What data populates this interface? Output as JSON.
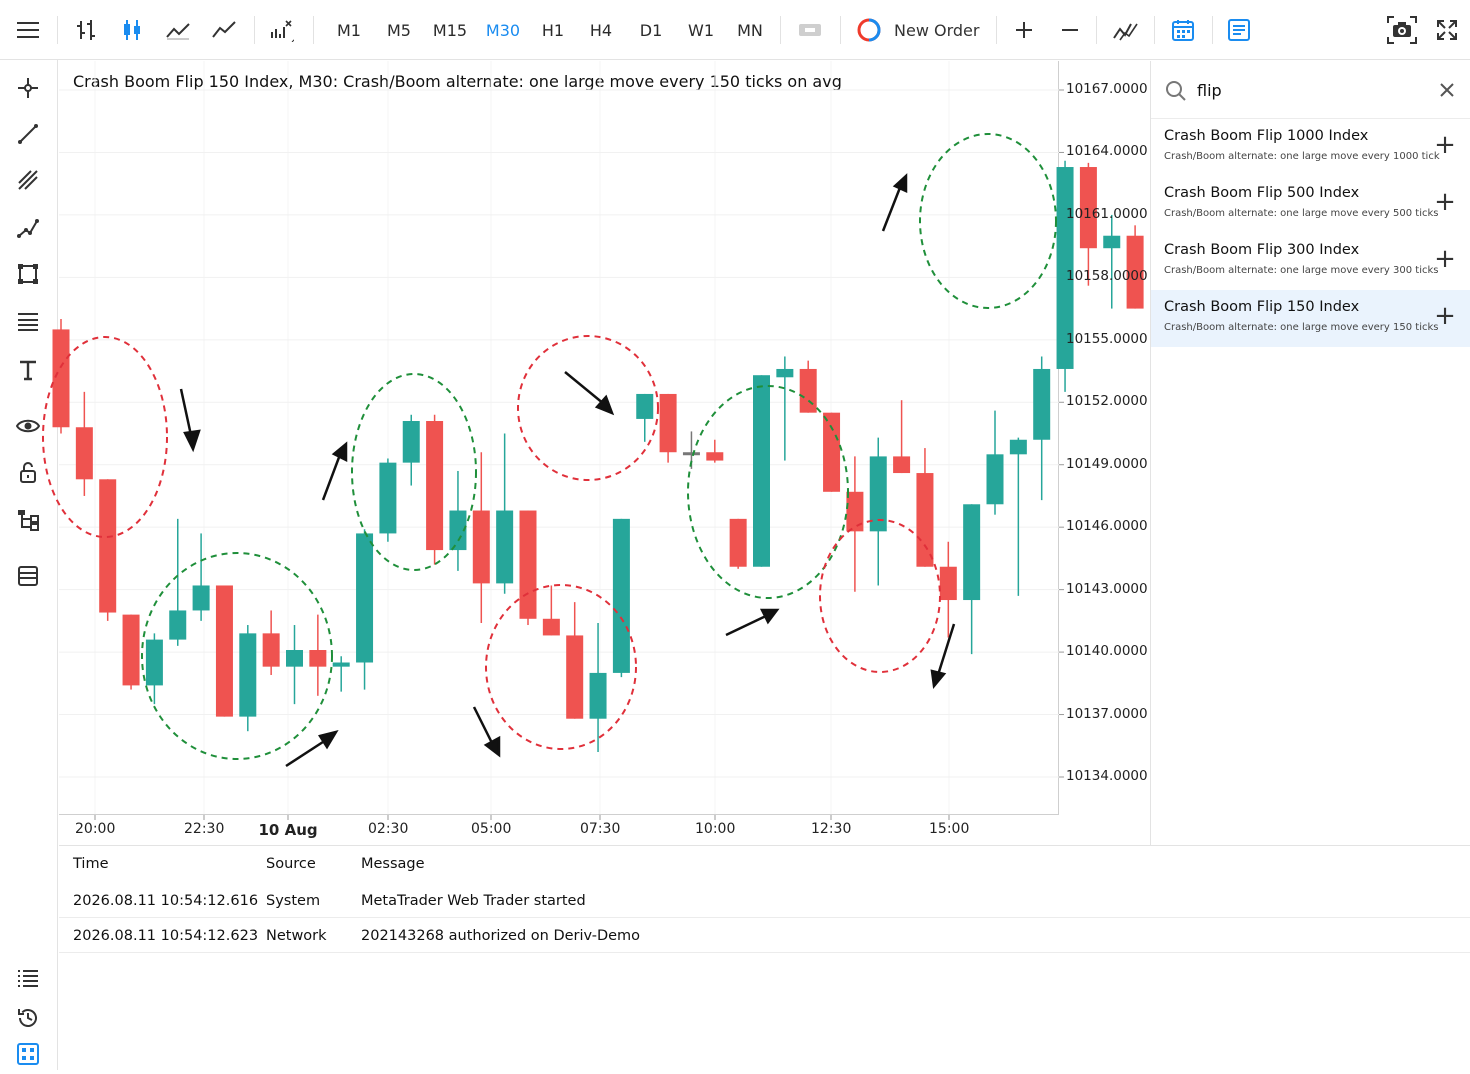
{
  "toolbar": {
    "timeframes": [
      "M1",
      "M5",
      "M15",
      "M30",
      "H1",
      "H4",
      "D1",
      "W1",
      "MN"
    ],
    "active_timeframe": "M30",
    "new_order_label": "New Order"
  },
  "chart": {
    "title": "Crash Boom Flip 150 Index, M30: Crash/Boom alternate: one large move every 150 ticks on avg",
    "y_labels": [
      "10167.0000",
      "10164.0000",
      "10161.0000",
      "10158.0000",
      "10155.0000",
      "10152.0000",
      "10149.0000",
      "10146.0000",
      "10143.0000",
      "10140.0000",
      "10137.0000",
      "10134.0000"
    ],
    "x_labels": [
      "20:00",
      "22:30",
      "10 Aug",
      "02:30",
      "05:00",
      "07:30",
      "10:00",
      "12:30",
      "15:00"
    ]
  },
  "chart_data": {
    "type": "candlestick",
    "symbol": "Crash Boom Flip 150 Index",
    "timeframe": "M30",
    "ylim": [
      10133,
      10168
    ],
    "up_color": "#26a69a",
    "down_color": "#ef5350",
    "candles": [
      {
        "o": 10155.5,
        "h": 10156.0,
        "l": 10150.5,
        "c": 10150.8
      },
      {
        "o": 10150.8,
        "h": 10152.5,
        "l": 10147.5,
        "c": 10148.3
      },
      {
        "o": 10148.3,
        "h": 10148.3,
        "l": 10141.5,
        "c": 10141.9
      },
      {
        "o": 10141.8,
        "h": 10141.8,
        "l": 10138.2,
        "c": 10138.4
      },
      {
        "o": 10138.4,
        "h": 10140.9,
        "l": 10137.5,
        "c": 10140.6
      },
      {
        "o": 10140.6,
        "h": 10146.4,
        "l": 10140.3,
        "c": 10142.0
      },
      {
        "o": 10142.0,
        "h": 10145.7,
        "l": 10141.5,
        "c": 10143.2
      },
      {
        "o": 10143.2,
        "h": 10143.2,
        "l": 10136.9,
        "c": 10136.9
      },
      {
        "o": 10136.9,
        "h": 10141.3,
        "l": 10136.2,
        "c": 10140.9
      },
      {
        "o": 10140.9,
        "h": 10142.0,
        "l": 10138.9,
        "c": 10139.3
      },
      {
        "o": 10139.3,
        "h": 10141.3,
        "l": 10137.5,
        "c": 10140.1
      },
      {
        "o": 10140.1,
        "h": 10141.8,
        "l": 10137.9,
        "c": 10139.3
      },
      {
        "o": 10139.3,
        "h": 10139.8,
        "l": 10138.1,
        "c": 10139.5
      },
      {
        "o": 10139.5,
        "h": 10145.9,
        "l": 10138.2,
        "c": 10145.7
      },
      {
        "o": 10145.7,
        "h": 10149.3,
        "l": 10145.3,
        "c": 10149.1
      },
      {
        "o": 10149.1,
        "h": 10151.4,
        "l": 10148.0,
        "c": 10151.1
      },
      {
        "o": 10151.1,
        "h": 10151.4,
        "l": 10144.2,
        "c": 10144.9
      },
      {
        "o": 10144.9,
        "h": 10148.7,
        "l": 10143.9,
        "c": 10146.8
      },
      {
        "o": 10146.8,
        "h": 10149.6,
        "l": 10141.4,
        "c": 10143.3
      },
      {
        "o": 10143.3,
        "h": 10150.5,
        "l": 10142.8,
        "c": 10146.8
      },
      {
        "o": 10146.8,
        "h": 10146.8,
        "l": 10141.3,
        "c": 10141.6
      },
      {
        "o": 10141.6,
        "h": 10143.2,
        "l": 10140.8,
        "c": 10140.8
      },
      {
        "o": 10140.8,
        "h": 10142.4,
        "l": 10136.8,
        "c": 10136.8
      },
      {
        "o": 10136.8,
        "h": 10141.4,
        "l": 10135.2,
        "c": 10139.0
      },
      {
        "o": 10139.0,
        "h": 10146.4,
        "l": 10138.8,
        "c": 10146.4
      },
      {
        "o": 10151.2,
        "h": 10152.4,
        "l": 10150.1,
        "c": 10152.4
      },
      {
        "o": 10152.4,
        "h": 10152.4,
        "l": 10149.1,
        "c": 10149.6
      },
      {
        "o": 10149.6,
        "h": 10150.6,
        "l": 10148.8,
        "c": 10149.5
      },
      {
        "o": 10149.6,
        "h": 10150.2,
        "l": 10149.1,
        "c": 10149.2
      },
      {
        "o": 10146.4,
        "h": 10146.4,
        "l": 10144.0,
        "c": 10144.1
      },
      {
        "o": 10144.1,
        "h": 10153.3,
        "l": 10144.1,
        "c": 10153.3
      },
      {
        "o": 10153.2,
        "h": 10154.2,
        "l": 10149.2,
        "c": 10153.6
      },
      {
        "o": 10153.6,
        "h": 10154.0,
        "l": 10151.5,
        "c": 10151.5
      },
      {
        "o": 10151.5,
        "h": 10151.5,
        "l": 10147.7,
        "c": 10147.7
      },
      {
        "o": 10147.7,
        "h": 10149.4,
        "l": 10142.9,
        "c": 10145.8
      },
      {
        "o": 10145.8,
        "h": 10150.3,
        "l": 10143.2,
        "c": 10149.4
      },
      {
        "o": 10149.4,
        "h": 10152.1,
        "l": 10148.6,
        "c": 10148.6
      },
      {
        "o": 10148.6,
        "h": 10149.8,
        "l": 10144.1,
        "c": 10144.1
      },
      {
        "o": 10144.1,
        "h": 10145.3,
        "l": 10140.7,
        "c": 10142.5
      },
      {
        "o": 10142.5,
        "h": 10147.1,
        "l": 10139.9,
        "c": 10147.1
      },
      {
        "o": 10147.1,
        "h": 10151.6,
        "l": 10146.6,
        "c": 10149.5
      },
      {
        "o": 10149.5,
        "h": 10150.3,
        "l": 10142.7,
        "c": 10150.2
      },
      {
        "o": 10150.2,
        "h": 10154.2,
        "l": 10147.3,
        "c": 10153.6
      },
      {
        "o": 10153.6,
        "h": 10163.6,
        "l": 10152.5,
        "c": 10163.3
      },
      {
        "o": 10163.3,
        "h": 10163.5,
        "l": 10157.6,
        "c": 10159.4
      },
      {
        "o": 10159.4,
        "h": 10161.0,
        "l": 10156.5,
        "c": 10160.0
      },
      {
        "o": 10160.0,
        "h": 10160.5,
        "l": 10156.5,
        "c": 10156.5
      }
    ]
  },
  "search": {
    "value": "flip",
    "results": [
      {
        "name": "Crash Boom Flip 1000 Index",
        "desc": "Crash/Boom alternate: one large move every 1000 tick"
      },
      {
        "name": "Crash Boom Flip 500 Index",
        "desc": "Crash/Boom alternate: one large move every 500 ticks"
      },
      {
        "name": "Crash Boom Flip 300 Index",
        "desc": "Crash/Boom alternate: one large move every 300 ticks"
      },
      {
        "name": "Crash Boom Flip 150 Index",
        "desc": "Crash/Boom alternate: one large move every 150 ticks"
      }
    ]
  },
  "journal": {
    "headers": {
      "time": "Time",
      "source": "Source",
      "message": "Message"
    },
    "rows": [
      {
        "time": "2026.08.11 10:54:12.616",
        "source": "System",
        "message": "MetaTrader Web Trader started"
      },
      {
        "time": "2026.08.11 10:54:12.623",
        "source": "Network",
        "message": "202143268 authorized on Deriv-Demo"
      }
    ]
  }
}
